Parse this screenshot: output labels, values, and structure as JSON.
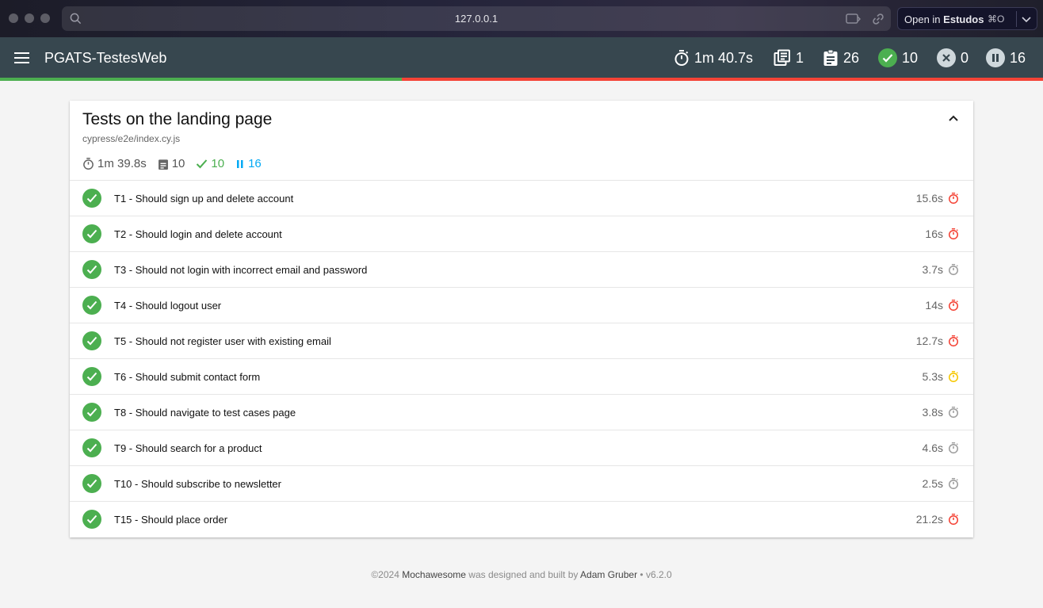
{
  "browser": {
    "url": "127.0.0.1",
    "open_in": {
      "prefix": "Open in",
      "app": "Estudos",
      "shortcut": "⌘O"
    }
  },
  "header": {
    "title": "PGATS-TestesWeb",
    "stats": {
      "duration": "1m 40.7s",
      "suites": "1",
      "tests": "26",
      "passes": "10",
      "failures": "0",
      "pending": "16"
    },
    "pass_ratio_percent": 38.5
  },
  "suite": {
    "title": "Tests on the landing page",
    "file": "cypress/e2e/index.cy.js",
    "duration": "1m 39.8s",
    "tests": "10",
    "passes": "10",
    "pending": "16"
  },
  "tests": [
    {
      "title": "T1 - Should sign up and delete account",
      "duration": "15.6s",
      "speed": "slow"
    },
    {
      "title": "T2 - Should login and delete account",
      "duration": "16s",
      "speed": "slow"
    },
    {
      "title": "T3 - Should not login with incorrect email and password",
      "duration": "3.7s",
      "speed": "fast"
    },
    {
      "title": "T4 - Should logout user",
      "duration": "14s",
      "speed": "slow"
    },
    {
      "title": "T5 - Should not register user with existing email",
      "duration": "12.7s",
      "speed": "slow"
    },
    {
      "title": "T6 - Should submit contact form",
      "duration": "5.3s",
      "speed": "medium"
    },
    {
      "title": "T8 - Should navigate to test cases page",
      "duration": "3.8s",
      "speed": "fast"
    },
    {
      "title": "T9 - Should search for a product",
      "duration": "4.6s",
      "speed": "fast"
    },
    {
      "title": "T10 - Should subscribe to newsletter",
      "duration": "2.5s",
      "speed": "fast"
    },
    {
      "title": "T15 - Should place order",
      "duration": "21.2s",
      "speed": "slow"
    }
  ],
  "footer": {
    "copyright": "©2024",
    "mochawesome": "Mochawesome",
    "designed_text": "was designed and built by",
    "author": "Adam Gruber",
    "version": "• v6.2.0"
  },
  "colors": {
    "header_bg": "#37474f",
    "pass": "#4caf50",
    "fail": "#f44336",
    "pending": "#03a9f4",
    "speed_slow": "#f44336",
    "speed_medium": "#f6c700",
    "speed_fast": "#9e9e9e"
  },
  "icons": {
    "duration": "stopwatch-icon",
    "suites": "library-books-icon",
    "tests": "assignment-icon",
    "passes": "check-circle-icon",
    "failures": "cancel-icon",
    "pending": "pause-circle-icon"
  }
}
